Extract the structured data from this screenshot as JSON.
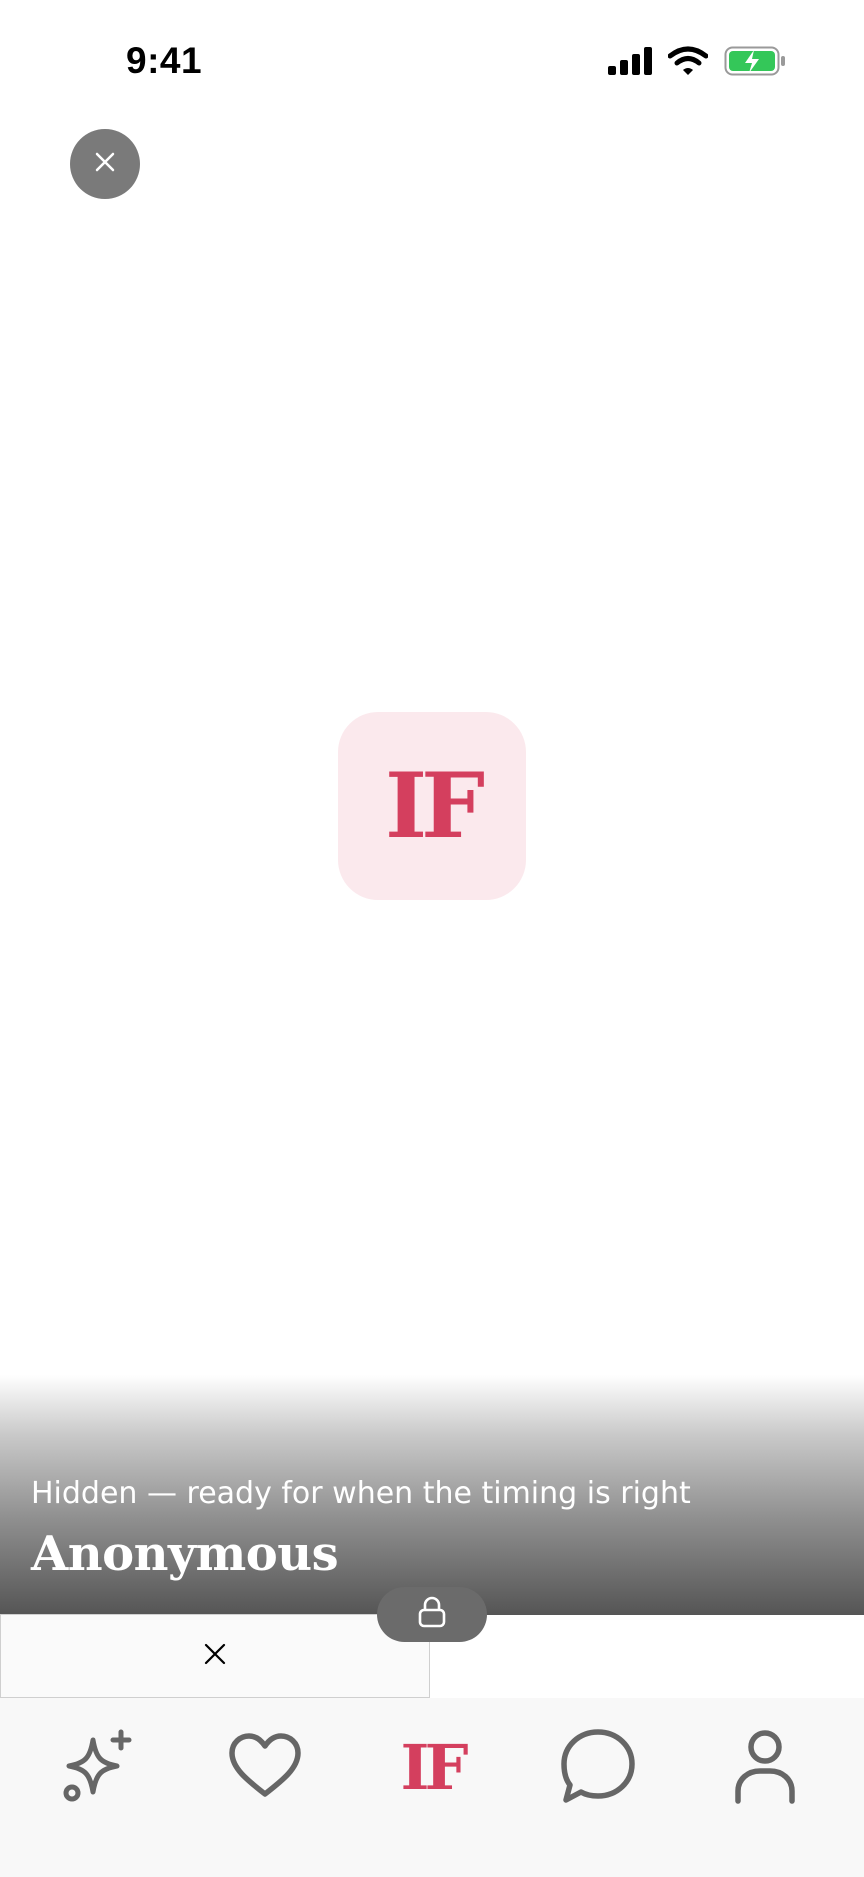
{
  "status_bar": {
    "time": "9:41",
    "icons": [
      "cellular-signal-icon",
      "wifi-icon",
      "battery-charging-icon"
    ],
    "battery_color": "#34c759"
  },
  "close_button": {
    "icon": "close-icon"
  },
  "logo": {
    "text": "IF",
    "color": "#d43f5e",
    "tile_color": "#fbe9ed"
  },
  "profile": {
    "subtitle": "Hidden — ready for when the timing is right",
    "name": "Anonymous"
  },
  "actions": {
    "dismiss_icon": "close-icon",
    "lock_icon": "lock-icon"
  },
  "tab_bar": {
    "tabs": [
      {
        "id": "discover",
        "icon": "sparkles-icon"
      },
      {
        "id": "likes",
        "icon": "heart-icon"
      },
      {
        "id": "home",
        "label": "IF"
      },
      {
        "id": "chats",
        "icon": "chat-bubble-icon"
      },
      {
        "id": "profile",
        "icon": "user-icon"
      }
    ],
    "active_color": "#d43f5e",
    "inactive_color": "#666666"
  }
}
